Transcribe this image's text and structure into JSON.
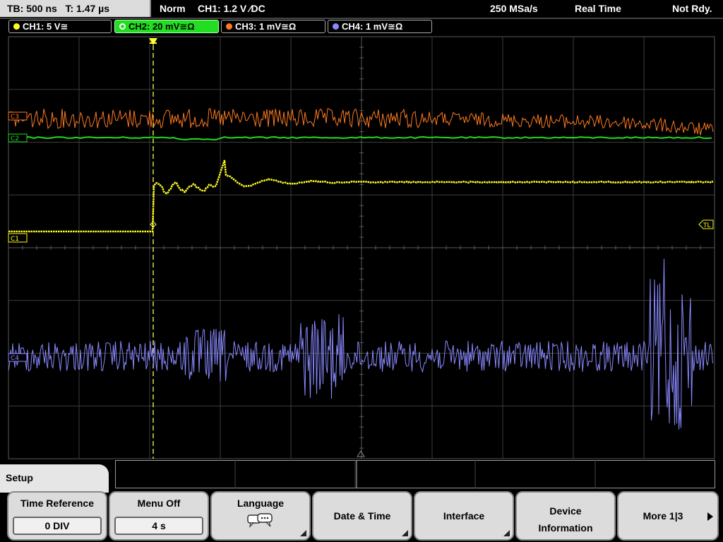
{
  "status": {
    "timebase": "TB: 500 ns",
    "trigger_time": "T: 1.47 µs",
    "mode": "Norm",
    "trigger": "CH1: 1.2 V  ∕DC",
    "sample_rate": "250 MSa/s",
    "acquisition": "Real Time",
    "state": "Not Rdy."
  },
  "channels": [
    {
      "label": "CH1: 5 V≅",
      "color": "#ffff22"
    },
    {
      "label": "CH2: 20 mV≅Ω",
      "color": "#22dd22"
    },
    {
      "label": "CH3: 1 mV≅Ω",
      "color": "#ff7a1f"
    },
    {
      "label": "CH4: 1 mV≅Ω",
      "color": "#8888ff"
    }
  ],
  "markers": {
    "ch1": "C1",
    "ch2": "C2",
    "ch3": "C3",
    "ch4": "C4",
    "trigger_level": "TL"
  },
  "menu": {
    "title": "Setup",
    "keys": {
      "time_reference": {
        "label": "Time Reference",
        "value": "0 DIV"
      },
      "menu_off": {
        "label": "Menu Off",
        "value": "4 s"
      },
      "language": {
        "label": "Language",
        "icon": "speech-bubbles-icon"
      },
      "date_time": {
        "label": "Date & Time"
      },
      "interface": {
        "label": "Interface"
      },
      "device_information": {
        "line1": "Device",
        "line2": "Information"
      },
      "more": {
        "label": "More 1|3"
      }
    }
  },
  "colors": {
    "grid": "#3c3c3c",
    "grid_center": "#5a5a5a",
    "ch1": "#ffff22",
    "ch2": "#22dd22",
    "ch3": "#ff7a1f",
    "ch4": "#8888ff",
    "trigger_line": "#ffff55"
  }
}
